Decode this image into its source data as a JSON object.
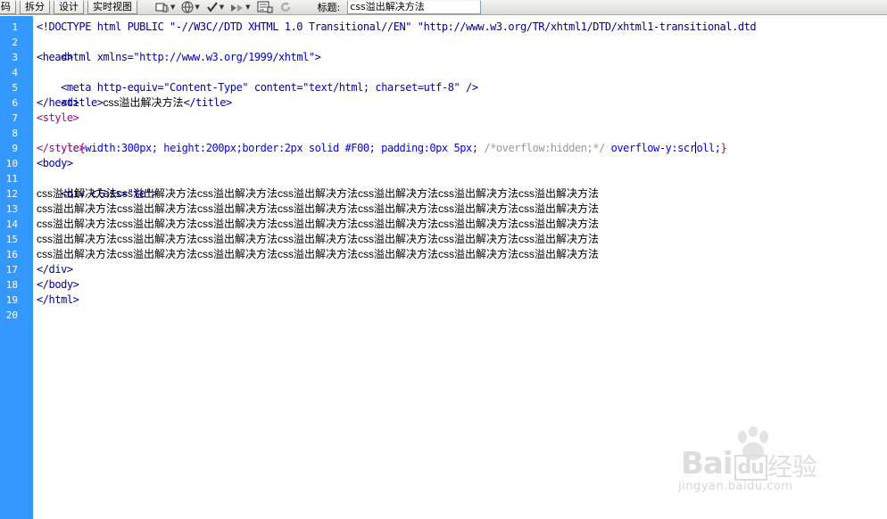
{
  "toolbar": {
    "buttons": [
      "码",
      "拆分",
      "设计",
      "实时视图"
    ],
    "icons": [
      "multiscreen-icon",
      "globe-icon",
      "validate-icon",
      "file-manage-icon",
      "visual-aids-icon",
      "refresh-icon"
    ],
    "title_label": "标题:",
    "title_value": "css溢出解决方法"
  },
  "gutter": {
    "line_numbers": [
      "1",
      "2",
      "3",
      "4",
      "5",
      "6",
      "7",
      "8",
      "9",
      "10",
      "11",
      "12",
      "13",
      "14",
      "15",
      "16",
      "17",
      "18",
      "19",
      "20"
    ],
    "color": "#3399ff"
  },
  "code": {
    "line1": "<!DOCTYPE html PUBLIC \"-//W3C//DTD XHTML 1.0 Transitional//EN\" \"http://www.w3.org/TR/xhtml1/DTD/xhtml1-transitional.dtd",
    "line2_tag": "<html xmlns=",
    "line2_str": "\"http://www.w3.org/1999/xhtml\"",
    "line2_end": ">",
    "line3": "<head>",
    "line4_tag": "<meta http-equiv=",
    "line4_str1": "\"Content-Type\"",
    "line4_mid": " content=",
    "line4_str2": "\"text/html; charset=utf-8\"",
    "line4_end": " />",
    "line5_open": "<title>",
    "line5_text": "css溢出解决方法",
    "line5_close": "</title>",
    "line6": "</head>",
    "line7": "<style>",
    "line8_sel": ".te{",
    "line8_props": "width:300px; height:200px;border:2px solid #F00; padding:0px 5px; ",
    "line8_comment": "/*overflow:hidden;*/",
    "line8_prop2a": " overflow-y:scr",
    "line8_prop2b": "oll;",
    "line8_close": "}",
    "line9": "</style>",
    "line10": "<body>",
    "line11_tag": "<div class=",
    "line11_str": "\"te\"",
    "line11_end": ">",
    "text_line": "css溢出解决方法css溢出解决方法css溢出解决方法css溢出解决方法css溢出解决方法css溢出解决方法css溢出解决方法",
    "line17": "</div>",
    "line18": "</body>",
    "line19": "</html>"
  },
  "watermark": {
    "brand": "Bai",
    "brand_suffix": "du",
    "sub": "经验",
    "url": "jingyan.baidu.com"
  }
}
